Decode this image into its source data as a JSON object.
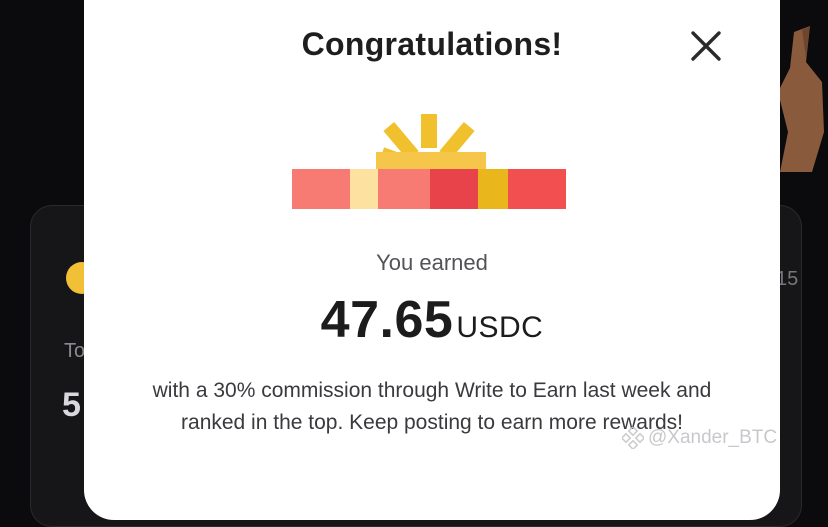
{
  "modal": {
    "title": "Congratulations!",
    "earned_label": "You earned",
    "amount": "47.65",
    "unit": "USDC",
    "description": "with a 30% commission through Write to Earn last week and ranked in the top. Keep posting to earn more rewards!",
    "close_icon": "close-icon",
    "gift_icon": "gift-icon"
  },
  "background": {
    "label_partial": "To",
    "value_partial": "5",
    "right_partial": "15"
  },
  "watermark": {
    "text": "@Xander_BTC",
    "icon": "binance-logo-icon"
  },
  "colors": {
    "modal_bg": "#ffffff",
    "page_bg": "#0b0b0d",
    "gift_ribbon": "#f0c12c",
    "gift_box_red": "#f25050",
    "gift_box_pink": "#f77b73",
    "text_dark": "#1c1c1c"
  }
}
